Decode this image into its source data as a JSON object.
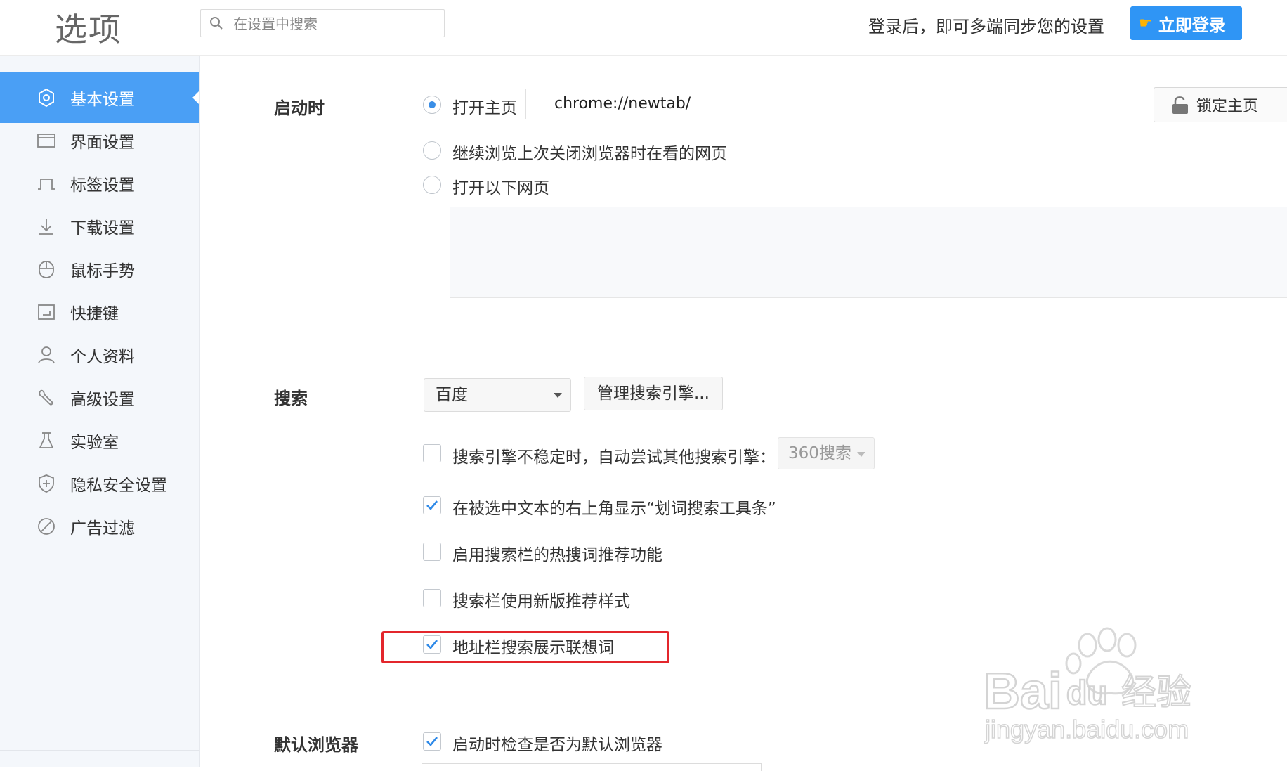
{
  "header": {
    "title": "选项",
    "search_placeholder": "在设置中搜索",
    "sync_text": "登录后，即可多端同步您的设置",
    "login_button": "立即登录"
  },
  "sidebar": {
    "items": [
      {
        "label": "基本设置",
        "icon": "settings-gear-icon",
        "active": true
      },
      {
        "label": "界面设置",
        "icon": "window-icon",
        "active": false
      },
      {
        "label": "标签设置",
        "icon": "tab-icon",
        "active": false
      },
      {
        "label": "下载设置",
        "icon": "download-icon",
        "active": false
      },
      {
        "label": "鼠标手势",
        "icon": "mouse-icon",
        "active": false
      },
      {
        "label": "快捷键",
        "icon": "shortcut-icon",
        "active": false
      },
      {
        "label": "个人资料",
        "icon": "user-icon",
        "active": false
      },
      {
        "label": "高级设置",
        "icon": "wrench-icon",
        "active": false
      },
      {
        "label": "实验室",
        "icon": "flask-icon",
        "active": false
      },
      {
        "label": "隐私安全设置",
        "icon": "shield-icon",
        "active": false
      },
      {
        "label": "广告过滤",
        "icon": "block-icon",
        "active": false
      }
    ]
  },
  "startup": {
    "label": "启动时",
    "option_homepage": "打开主页",
    "homepage_url": "chrome://newtab/",
    "lock_button": "锁定主页",
    "option_continue": "继续浏览上次关闭浏览器时在看的网页",
    "option_pages": "打开以下网页",
    "selected": "打开主页"
  },
  "search": {
    "label": "搜索",
    "engine": "百度",
    "manage_button": "管理搜索引擎...",
    "fallback_label": "搜索引擎不稳定时，自动尝试其他搜索引擎：",
    "fallback_engine": "360搜索",
    "options": [
      {
        "label": "搜索引擎不稳定时，自动尝试其他搜索引擎：",
        "checked": false
      },
      {
        "label": "在被选中文本的右上角显示“划词搜索工具条”",
        "checked": true
      },
      {
        "label": "启用搜索栏的热搜词推荐功能",
        "checked": false
      },
      {
        "label": "搜索栏使用新版推荐样式",
        "checked": false
      },
      {
        "label": "地址栏搜索展示联想词",
        "checked": true
      }
    ]
  },
  "default_browser": {
    "label": "默认浏览器",
    "option": "启动时检查是否为默认浏览器",
    "checked": true
  },
  "watermark": {
    "brand": "Baidu经验",
    "url": "jingyan.baidu.com"
  },
  "colors": {
    "accent": "#4a9ff5",
    "login_button": "#2f95f5",
    "highlight": "#e3262c"
  }
}
